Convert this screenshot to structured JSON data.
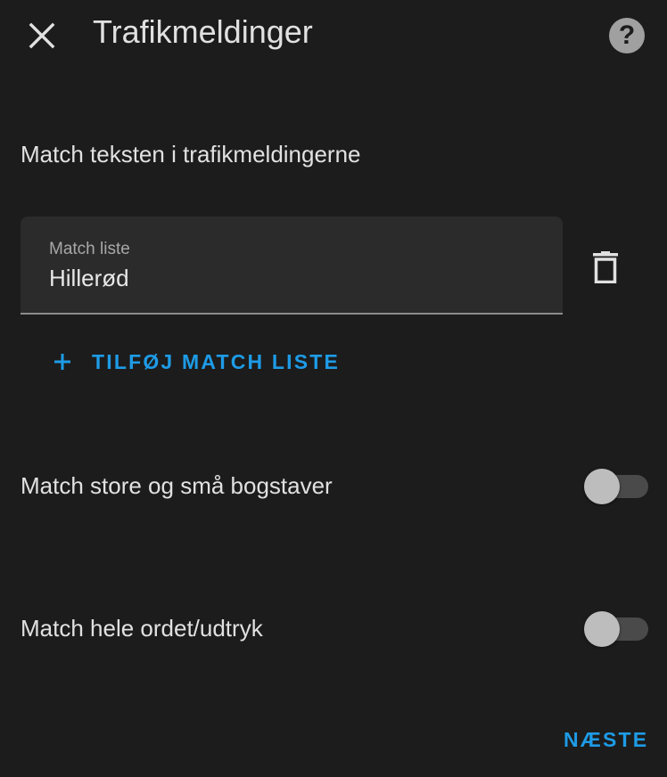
{
  "dialog": {
    "title": "Trafikmeldinger",
    "close_icon": "close-icon",
    "help_icon": "help-circle-icon",
    "help_glyph": "?"
  },
  "match_section": {
    "label": "Match teksten i trafikmeldingerne",
    "field": {
      "label": "Match liste",
      "value": "Hillerød"
    },
    "delete_icon": "trash-icon",
    "add_button": {
      "icon": "plus-icon",
      "label": "TILFØJ MATCH LISTE"
    }
  },
  "toggles": [
    {
      "label": "Match store og små bogstaver",
      "checked": false
    },
    {
      "label": "Match hele ordet/udtryk",
      "checked": false
    }
  ],
  "footer": {
    "next_label": "NÆSTE"
  },
  "colors": {
    "background": "#1c1c1c",
    "accent": "#1e9be6",
    "text": "#e1e1e1",
    "field_bg": "#2b2b2b"
  }
}
